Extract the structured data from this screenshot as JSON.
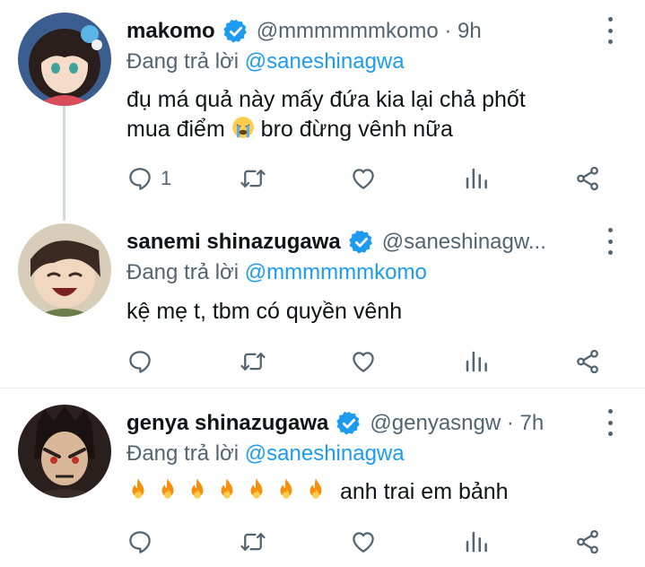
{
  "replying_label": "Đang trả lời",
  "tweets": [
    {
      "name": "makomo",
      "handle": "@mmmmmmkomo · 9h",
      "replying_to": "@saneshinagwa",
      "text_line1": "đụ má quả này mấy đứa kia lại chả phốt",
      "text_line2_before": "mua điểm",
      "text_line2_after": "bro đừng vênh nữa",
      "reply_count": "1",
      "inline_emoji": [
        "crying-face"
      ]
    },
    {
      "name": "sanemi shinazugawa",
      "handle": "@saneshinagw...",
      "replying_to": "@mmmmmmkomo",
      "text": "kệ mẹ t, tbm có quyền vênh",
      "reply_count": ""
    },
    {
      "name": "genya shinazugawa",
      "handle": "@genyasngw · 7h",
      "replying_to": "@saneshinagwa",
      "text": "anh trai em bảnh",
      "fire_emoji_count": 7,
      "reply_count": ""
    }
  ],
  "colors": {
    "text": "#0f1419",
    "secondary": "#536471",
    "mention": "#1d9bf0",
    "verified": "#1d9bf0",
    "separator": "#e6ecf0",
    "thread_line": "#cfd9de"
  },
  "icons": [
    "reply-icon",
    "retweet-icon",
    "like-icon",
    "views-icon",
    "share-icon",
    "verified-badge-icon",
    "more-icon"
  ]
}
